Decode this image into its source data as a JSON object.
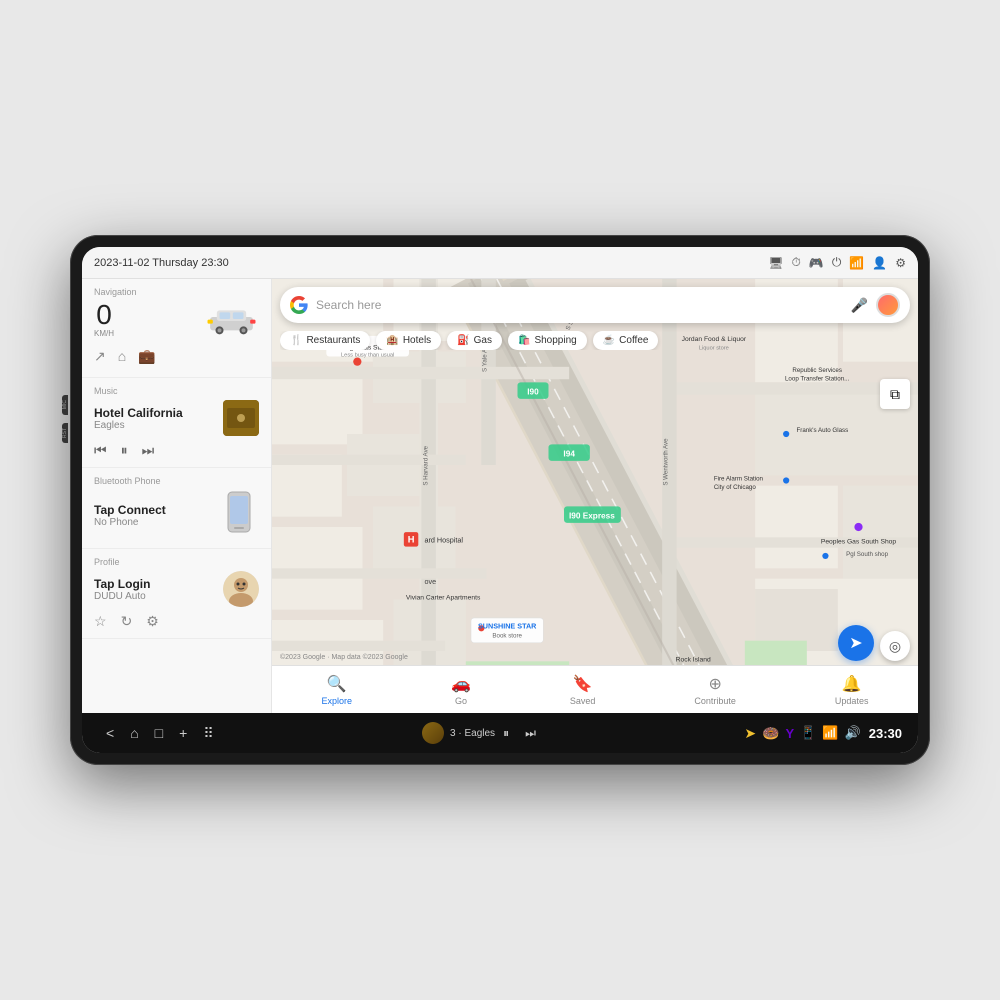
{
  "device": {
    "side_buttons": [
      "MIC",
      "RST"
    ]
  },
  "status_bar": {
    "datetime": "2023-11-02 Thursday 23:30",
    "icons": [
      "display-icon",
      "timer-icon",
      "steering-icon",
      "power-icon",
      "wifi-icon",
      "account-icon",
      "settings-icon"
    ]
  },
  "sidebar": {
    "navigation": {
      "label": "Navigation",
      "speed": "0",
      "speed_unit": "KM/H"
    },
    "music": {
      "label": "Music",
      "title": "Hotel California",
      "artist": "Eagles"
    },
    "bluetooth": {
      "label": "Bluetooth Phone",
      "title": "Tap Connect",
      "subtitle": "No Phone"
    },
    "profile": {
      "label": "Profile",
      "name": "Tap Login",
      "subtitle": "DUDU Auto"
    }
  },
  "map": {
    "search_placeholder": "Search here",
    "categories": [
      "Restaurants",
      "Hotels",
      "Gas",
      "Shopping",
      "Coffee"
    ],
    "category_icons": [
      "🍴",
      "🏨",
      "⛽",
      "🛍️",
      "☕"
    ],
    "places": [
      {
        "name": "Citgo Gas Station",
        "sub": "Less busy than usual"
      },
      {
        "name": "Jordan Food & Liquor",
        "sub": "Liquor store"
      },
      {
        "name": "Frank's Auto Glass"
      },
      {
        "name": "Republic Services Loop Transfer Station"
      },
      {
        "name": "Fire Alarm Station City of Chicago"
      },
      {
        "name": "Peoples Gas South Shop"
      },
      {
        "name": "Pgl South shop"
      },
      {
        "name": "Vivian Carter Apartments"
      },
      {
        "name": "SUNSHINE STAR",
        "sub": "Book store"
      },
      {
        "name": "Rock Island Metraril Bridge"
      }
    ],
    "bottom_tabs": [
      {
        "label": "Explore",
        "active": true
      },
      {
        "label": "Go",
        "active": false
      },
      {
        "label": "Saved",
        "active": false
      },
      {
        "label": "Contribute",
        "active": false
      },
      {
        "label": "Updates",
        "active": false
      }
    ],
    "copyright": "©2023 Google · Map data ©2023 Google"
  },
  "system_bar": {
    "back_label": "<",
    "home_label": "⌂",
    "recent_label": "□",
    "add_label": "+",
    "grid_label": "⠿",
    "music_track": "3 · Eagles",
    "time": "23:30"
  }
}
